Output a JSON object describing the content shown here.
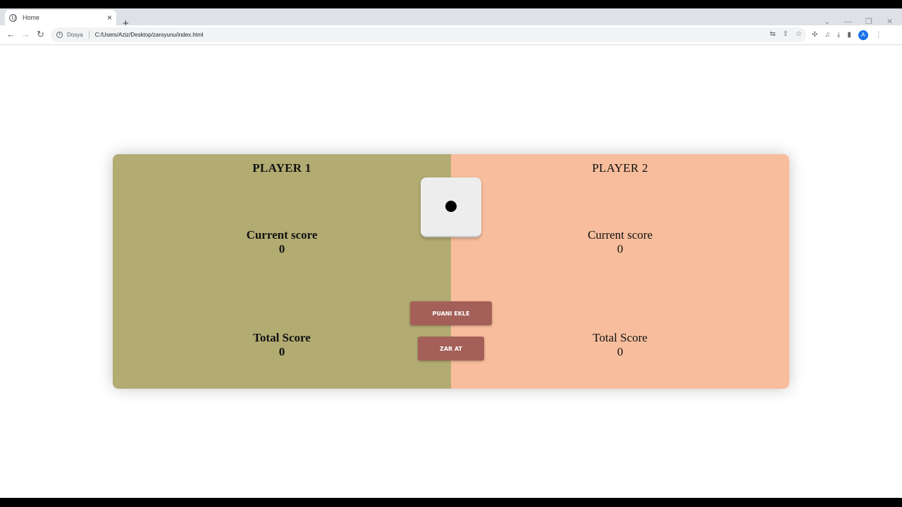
{
  "browser": {
    "tab_title": "Home",
    "tab_close": "×",
    "new_tab": "+",
    "window_controls": [
      "⌄",
      "—",
      "❐",
      "✕"
    ],
    "nav": {
      "back": "←",
      "forward": "→",
      "reload": "↻"
    },
    "omnibox": {
      "security_label": "Dosya",
      "url": "C:/Users/Aziz/Desktop/zaroyunu/index.html"
    },
    "avatar_letter": "A"
  },
  "game": {
    "player1": {
      "name": "PLAYER 1",
      "current_label": "Current score",
      "current_value": "0",
      "total_label": "Total Score",
      "total_value": "0"
    },
    "player2": {
      "name": "PLAYER 2",
      "current_label": "Current score",
      "current_value": "0",
      "total_label": "Total Score",
      "total_value": "0"
    },
    "dice_value": 1,
    "buttons": {
      "add_score": "PUANI EKLE",
      "roll": "ZAR AT"
    },
    "colors": {
      "player1_bg": "#b2ab72",
      "player2_bg": "#f7bd9c",
      "button_bg": "#a35f58"
    }
  }
}
